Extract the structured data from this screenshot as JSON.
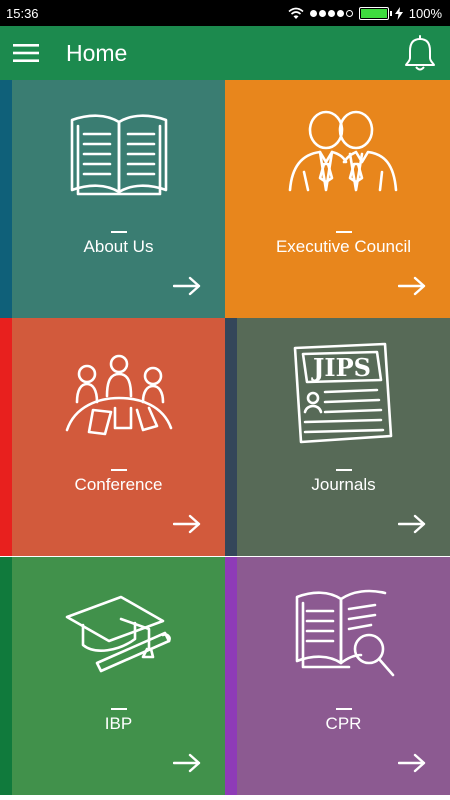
{
  "statusbar": {
    "time": "15:36",
    "battery_text": "100%",
    "battery_level": 1.0,
    "icons": [
      "wifi-icon",
      "signal-dots-icon",
      "battery-icon",
      "charging-bolt-icon"
    ]
  },
  "appbar": {
    "title": "Home",
    "menu_icon": "hamburger-menu-icon",
    "notification_icon": "bell-icon",
    "color": "#1c8a4e"
  },
  "tiles": [
    {
      "label": "About Us",
      "icon": "open-book-icon",
      "color": "#3a7d72",
      "accent": "#0f6079"
    },
    {
      "label": "Executive Council",
      "icon": "council-members-icon",
      "color": "#e8861c",
      "accent": "#e8861c"
    },
    {
      "label": "Conference",
      "icon": "conference-people-icon",
      "color": "#d25a3c",
      "accent": "#e8201e"
    },
    {
      "label": "Journals",
      "icon": "journal-jips-icon",
      "color": "#576a57",
      "accent": "#34465a"
    },
    {
      "label": "IBP",
      "icon": "graduation-cap-icon",
      "color": "#41914b",
      "accent": "#107a3c"
    },
    {
      "label": "CPR",
      "icon": "book-magnifier-icon",
      "color": "#8c5a91",
      "accent": "#8e3bb7"
    }
  ],
  "journal_logo_text": "JIPS",
  "tile_arrow_icon": "arrow-right-icon"
}
